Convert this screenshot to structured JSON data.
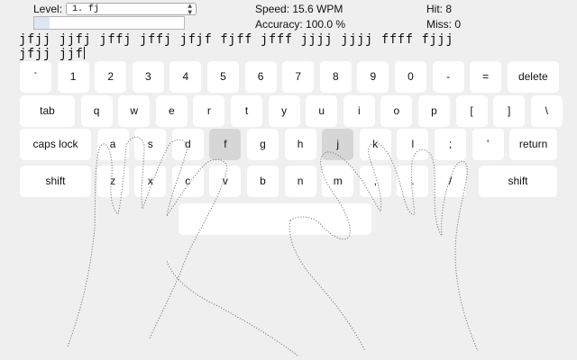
{
  "header": {
    "level_label": "Level:",
    "level_value": "1. fj",
    "speed": "Speed: 15.6 WPM",
    "accuracy": "Accuracy: 100.0 %",
    "hit": "Hit: 8",
    "miss": "Miss: 0",
    "progress_fraction": 0.1
  },
  "practice": {
    "line1": "jfjj jjfj jffj jffj jfjf fjff jfff jjjj jjjj ffff fjjj",
    "line2": "jfjj jjf"
  },
  "keyboard": {
    "highlight_color": "#d6d6d6",
    "rows": [
      [
        "`",
        "1",
        "2",
        "3",
        "4",
        "5",
        "6",
        "7",
        "8",
        "9",
        "0",
        "-",
        "=",
        "delete"
      ],
      [
        "tab",
        "q",
        "w",
        "e",
        "r",
        "t",
        "y",
        "u",
        "i",
        "o",
        "p",
        "[",
        "]",
        "\\"
      ],
      [
        "caps lock",
        "a",
        "s",
        "d",
        "f",
        "g",
        "h",
        "j",
        "k",
        "l",
        ";",
        "'",
        "return"
      ],
      [
        "shift",
        "z",
        "x",
        "c",
        "v",
        "b",
        "n",
        "m",
        ",",
        ".",
        "/",
        "shift"
      ]
    ],
    "highlighted": [
      "f",
      "j"
    ]
  },
  "icons": {
    "select_arrow": "chevron-updown-icon"
  }
}
